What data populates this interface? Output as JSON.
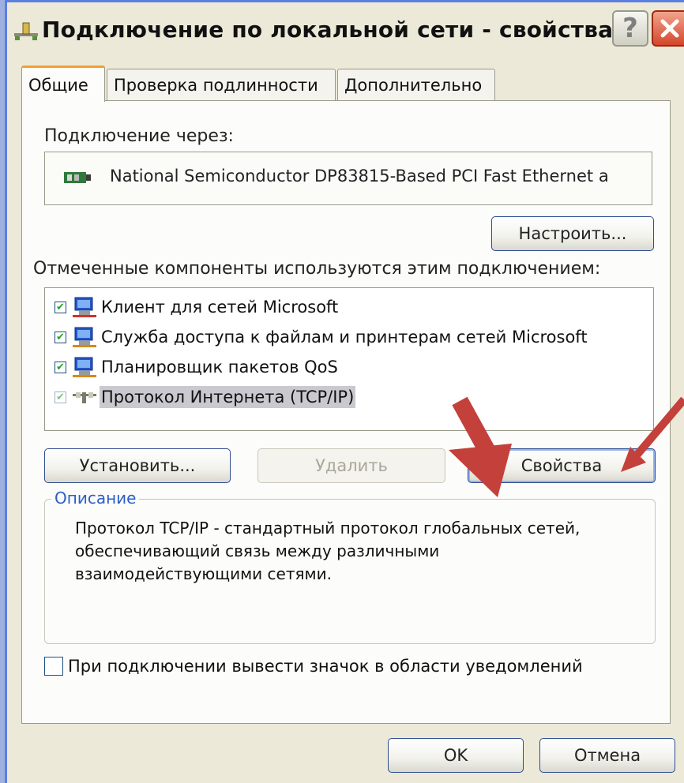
{
  "window": {
    "title": "Подключение по локальной сети - свойства",
    "help_label": "?",
    "close_label": "✕"
  },
  "tabs": [
    {
      "label": "Общие",
      "active": true
    },
    {
      "label": "Проверка подлинности",
      "active": false
    },
    {
      "label": "Дополнительно",
      "active": false
    }
  ],
  "general": {
    "connect_using_label": "Подключение через:",
    "adapter_name": "National Semiconductor DP83815-Based PCI Fast Ethernet a",
    "configure_label": "Настроить...",
    "components_label": "Отмеченные компоненты используются этим подключением:",
    "components": [
      {
        "label": "Клиент для сетей Microsoft",
        "checked": true,
        "icon": "network-client-icon"
      },
      {
        "label": "Служба доступа к файлам и принтерам сетей Microsoft",
        "checked": true,
        "icon": "file-printer-sharing-icon"
      },
      {
        "label": "Планировщик пакетов QoS",
        "checked": true,
        "icon": "qos-scheduler-icon"
      },
      {
        "label": "Протокол Интернета (TCP/IP)",
        "checked": true,
        "selected": true,
        "icon": "protocol-icon"
      }
    ],
    "install_label": "Установить...",
    "uninstall_label": "Удалить",
    "properties_label": "Свойства",
    "description_legend": "Описание",
    "description_text": "Протокол TCP/IP - стандартный протокол глобальных сетей, обеспечивающий связь между различными взаимодействующими сетями.",
    "notify_label": "При подключении вывести значок в области уведомлений",
    "notify_checked": false
  },
  "footer": {
    "ok_label": "OK",
    "cancel_label": "Отмена"
  },
  "annotation": {
    "arrow_color": "#c4403b"
  }
}
